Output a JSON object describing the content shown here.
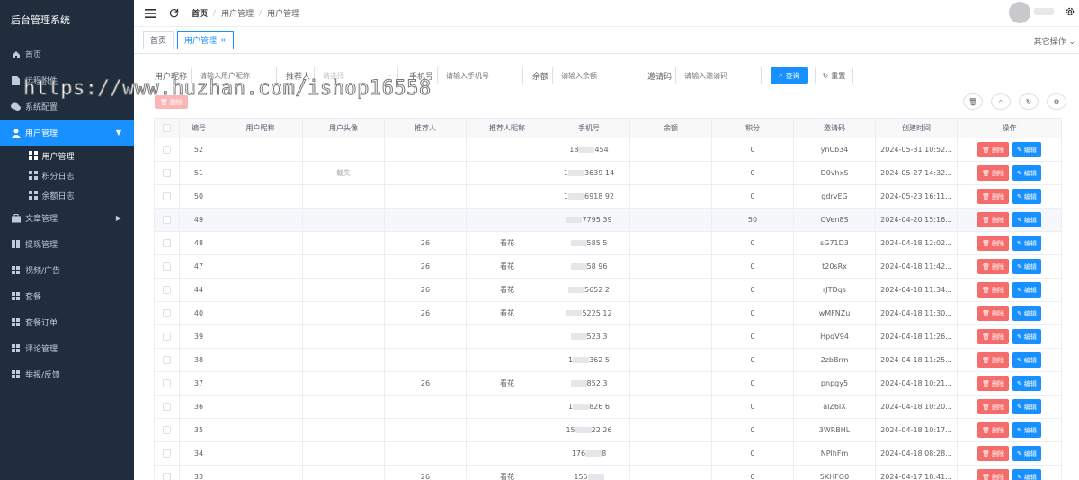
{
  "app_title": "后台管理系统",
  "watermark": "https://www.huzhan.com/ishop16558",
  "sidebar": {
    "items": [
      {
        "label": "首页",
        "icon": "home-icon"
      },
      {
        "label": "远程附件",
        "icon": "document-icon"
      },
      {
        "label": "系统配置",
        "icon": "chat-icon"
      },
      {
        "label": "用户管理",
        "icon": "user-icon",
        "active": true,
        "expanded": true
      },
      {
        "label": "文章管理",
        "icon": "briefcase-icon"
      },
      {
        "label": "提现管理",
        "icon": "grid-icon"
      },
      {
        "label": "视频/广告",
        "icon": "grid-icon"
      },
      {
        "label": "套餐",
        "icon": "grid-icon"
      },
      {
        "label": "套餐订单",
        "icon": "grid-icon"
      },
      {
        "label": "评论管理",
        "icon": "grid-icon"
      },
      {
        "label": "举报/反馈",
        "icon": "grid-icon"
      }
    ],
    "user_sub": [
      "用户管理",
      "积分日志",
      "余额日志"
    ]
  },
  "breadcrumb": [
    "首页",
    "用户管理",
    "用户管理"
  ],
  "tabs": [
    {
      "label": "首页"
    },
    {
      "label": "用户管理",
      "active": true
    }
  ],
  "other_ops": "其它操作",
  "search": {
    "nickname_label": "用户昵称",
    "nickname_placeholder": "请输入用户昵称",
    "referrer_label": "推荐人",
    "referrer_placeholder": "请选择",
    "phone_label": "手机号",
    "phone_placeholder": "请输入手机号",
    "balance_label": "余额",
    "balance_placeholder": "请输入余额",
    "invite_label": "邀请码",
    "invite_placeholder": "请输入邀请码",
    "query_btn": "查询",
    "reset_btn": "重置"
  },
  "batch_delete": "删除",
  "table": {
    "columns": [
      "编号",
      "用户昵称",
      "用户头像",
      "推荐人",
      "推荐人昵称",
      "手机号",
      "余额",
      "积分",
      "邀请码",
      "创建时间",
      "操作"
    ],
    "delete_label": "删除",
    "edit_label": "编辑",
    "rows": [
      {
        "id": "52",
        "avatar": "",
        "referrer": "",
        "ref_nick": "",
        "phone_a": "18",
        "phone_b": "454",
        "points": "0",
        "code": "ynCb34",
        "time": "2024-05-31 10:52..."
      },
      {
        "id": "51",
        "avatar": "载失",
        "referrer": "",
        "ref_nick": "",
        "phone_a": "1",
        "phone_b": "3639  14",
        "points": "0",
        "code": "D0vhxS",
        "time": "2024-05-27 14:32..."
      },
      {
        "id": "50",
        "avatar": "",
        "referrer": "",
        "ref_nick": "",
        "phone_a": "1",
        "phone_b": "6918  92",
        "points": "0",
        "code": "gdrvEG",
        "time": "2024-05-23 16:11..."
      },
      {
        "id": "49",
        "avatar": "",
        "referrer": "",
        "ref_nick": "",
        "phone_a": "",
        "phone_b": "7795  39",
        "points": "50",
        "code": "OVen8S",
        "time": "2024-04-20 15:16..."
      },
      {
        "id": "48",
        "avatar": "",
        "referrer": "26",
        "ref_nick": "看花",
        "phone_a": "",
        "phone_b": "585  5",
        "points": "0",
        "code": "sG71D3",
        "time": "2024-04-18 12:02..."
      },
      {
        "id": "47",
        "avatar": "",
        "referrer": "26",
        "ref_nick": "看花",
        "phone_a": "",
        "phone_b": "58  96",
        "points": "0",
        "code": "t20sRx",
        "time": "2024-04-18 11:42..."
      },
      {
        "id": "44",
        "avatar": "",
        "referrer": "26",
        "ref_nick": "看花",
        "phone_a": "",
        "phone_b": "5652  2",
        "points": "0",
        "code": "rJTDqs",
        "time": "2024-04-18 11:34..."
      },
      {
        "id": "40",
        "avatar": "",
        "referrer": "26",
        "ref_nick": "看花",
        "phone_a": "",
        "phone_b": "5225  12",
        "points": "0",
        "code": "wMFNZu",
        "time": "2024-04-18 11:30..."
      },
      {
        "id": "39",
        "avatar": "",
        "referrer": "",
        "ref_nick": "",
        "phone_a": "",
        "phone_b": "523  3",
        "points": "0",
        "code": "HpqV94",
        "time": "2024-04-18 11:26..."
      },
      {
        "id": "38",
        "avatar": "",
        "referrer": "",
        "ref_nick": "",
        "phone_a": "1",
        "phone_b": "362  5",
        "points": "0",
        "code": "2zbBrm",
        "time": "2024-04-18 11:25..."
      },
      {
        "id": "37",
        "avatar": "",
        "referrer": "26",
        "ref_nick": "看花",
        "phone_a": "",
        "phone_b": "852  3",
        "points": "0",
        "code": "pnpgy5",
        "time": "2024-04-18 10:21..."
      },
      {
        "id": "36",
        "avatar": "",
        "referrer": "",
        "ref_nick": "",
        "phone_a": "1",
        "phone_b": "826  6",
        "points": "0",
        "code": "alZ6IX",
        "time": "2024-04-18 10:20..."
      },
      {
        "id": "35",
        "avatar": "",
        "referrer": "",
        "ref_nick": "",
        "phone_a": "15",
        "phone_b": "22  26",
        "points": "0",
        "code": "3WRBHL",
        "time": "2024-04-18 10:17..."
      },
      {
        "id": "34",
        "avatar": "",
        "referrer": "",
        "ref_nick": "",
        "phone_a": "176",
        "phone_b": "8",
        "points": "0",
        "code": "NPlhFm",
        "time": "2024-04-18 08:28..."
      },
      {
        "id": "33",
        "avatar": "",
        "referrer": "26",
        "ref_nick": "看花",
        "phone_a": "155",
        "phone_b": "",
        "points": "0",
        "code": "5KHFO0",
        "time": "2024-04-17 18:41..."
      }
    ]
  }
}
